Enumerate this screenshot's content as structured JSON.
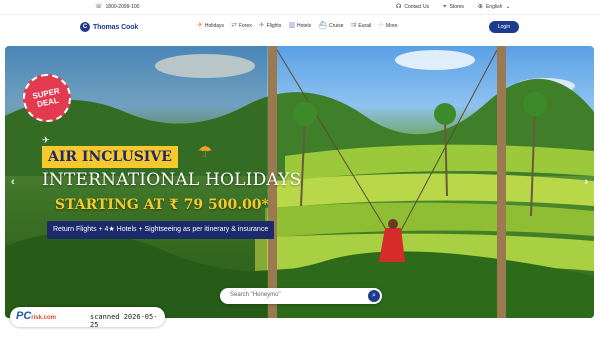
{
  "utility": {
    "phone": "1800-2099-100",
    "contact": "Contact Us",
    "stores": "Stores",
    "language": "English"
  },
  "header": {
    "logo_letter": "C",
    "logo_text": "Thomas Cook",
    "nav": [
      {
        "label": "Holidays",
        "icon": "palm-plane-icon"
      },
      {
        "label": "Forex",
        "icon": "forex-icon"
      },
      {
        "label": "Flights",
        "icon": "plane-icon"
      },
      {
        "label": "Hotels",
        "icon": "hotel-icon"
      },
      {
        "label": "Cruise",
        "icon": "cruise-icon"
      },
      {
        "label": "Eurail",
        "icon": "train-icon"
      },
      {
        "label": "More",
        "icon": "more-icon"
      }
    ],
    "login_label": "Login"
  },
  "hero": {
    "deal_line1": "SUPER",
    "deal_line2": "DEAL",
    "tag": "AIR INCLUSIVE",
    "headline": "INTERNATIONAL HOLIDAYS",
    "price_text": "STARTING AT ₹ 79 500.00*",
    "inclusions": "Return Flights  +  4★ Hotels  +  Sightseeing as per itinerary & insurance",
    "prev_icon": "chevron-left-icon",
    "next_icon": "chevron-right-icon"
  },
  "search": {
    "placeholder": "Search \"Honeymo\""
  },
  "watermark": {
    "brand": "PC",
    "brand_suffix": "risk.com",
    "stamp": "scanned 2026-05-25"
  },
  "colors": {
    "brand": "#1c3b8c",
    "deal": "#e23a4f",
    "accent": "#f7c92c"
  }
}
